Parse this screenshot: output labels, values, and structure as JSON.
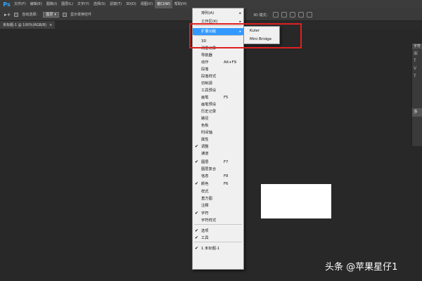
{
  "menubar": {
    "logo": "Ps",
    "items": [
      "文件(F)",
      "编辑(E)",
      "图像(I)",
      "图层(L)",
      "文字(Y)",
      "选择(S)",
      "滤镜(T)",
      "3D(D)",
      "视图(V)",
      "窗口(W)",
      "帮助(H)"
    ],
    "active": "窗口(W)"
  },
  "options": {
    "move_icon": "▸+",
    "auto_select_label": "自动选择：",
    "auto_select_value": "图层",
    "show_transform_label": "显示变换控件",
    "mode_3d_label": "3D 模式："
  },
  "tab": {
    "title": "未标题-1 @ 100%(RGB/8)",
    "close": "×"
  },
  "window_menu": {
    "items": [
      {
        "label": "排列(A)",
        "arrow": "▸"
      },
      {
        "label": "工作区(K)",
        "arrow": "▸"
      },
      {
        "label": "扩展功能",
        "arrow": "▸",
        "highlight": true
      },
      {
        "label": "3D"
      },
      {
        "label": "测量记录"
      },
      {
        "label": "导航器"
      },
      {
        "label": "动作",
        "shortcut": "Alt+F9"
      },
      {
        "label": "段落"
      },
      {
        "label": "段落样式"
      },
      {
        "label": "仿制源"
      },
      {
        "label": "工具预设"
      },
      {
        "label": "画笔",
        "shortcut": "F5"
      },
      {
        "label": "画笔预设"
      },
      {
        "label": "历史记录"
      },
      {
        "label": "路径"
      },
      {
        "label": "色板"
      },
      {
        "label": "时间轴"
      },
      {
        "label": "属性"
      },
      {
        "label": "调整",
        "checked": true
      },
      {
        "label": "通道"
      },
      {
        "label": "图层",
        "shortcut": "F7",
        "checked": true
      },
      {
        "label": "图层复合"
      },
      {
        "label": "信息",
        "shortcut": "F8"
      },
      {
        "label": "颜色",
        "shortcut": "F6",
        "checked": true
      },
      {
        "label": "样式"
      },
      {
        "label": "直方图"
      },
      {
        "label": "注释"
      },
      {
        "label": "字符",
        "checked": true
      },
      {
        "label": "字符样式"
      },
      {
        "label": "选项",
        "checked": true
      },
      {
        "label": "工具",
        "checked": true
      },
      {
        "label": "1 未标题-1",
        "checked": true
      }
    ],
    "check_mark": "✔"
  },
  "submenu": {
    "items": [
      "Kuler",
      "Mini Bridge"
    ]
  },
  "right_panel": {
    "header": "字符",
    "field": "宋",
    "bottom": "多"
  },
  "watermark": "头条 @苹果星仔1",
  "colors": {
    "highlight": "#3399ff",
    "annotation": "#e02020",
    "background": "#282828"
  }
}
